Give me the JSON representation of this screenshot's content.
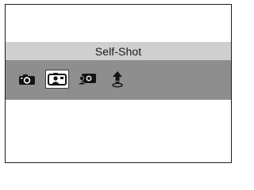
{
  "menu": {
    "title": "Self-Shot",
    "modes": [
      {
        "icon": "camera-icon",
        "selected": false
      },
      {
        "icon": "self-shot-icon",
        "selected": true
      },
      {
        "icon": "group-shot-icon",
        "selected": false
      },
      {
        "icon": "upload-icon",
        "selected": false
      }
    ]
  },
  "colors": {
    "title_bar": "#cfcfcf",
    "icon_bar": "#8e8e8e",
    "frame_border": "#1c1c1c",
    "selected_bg": "#ffffff"
  }
}
